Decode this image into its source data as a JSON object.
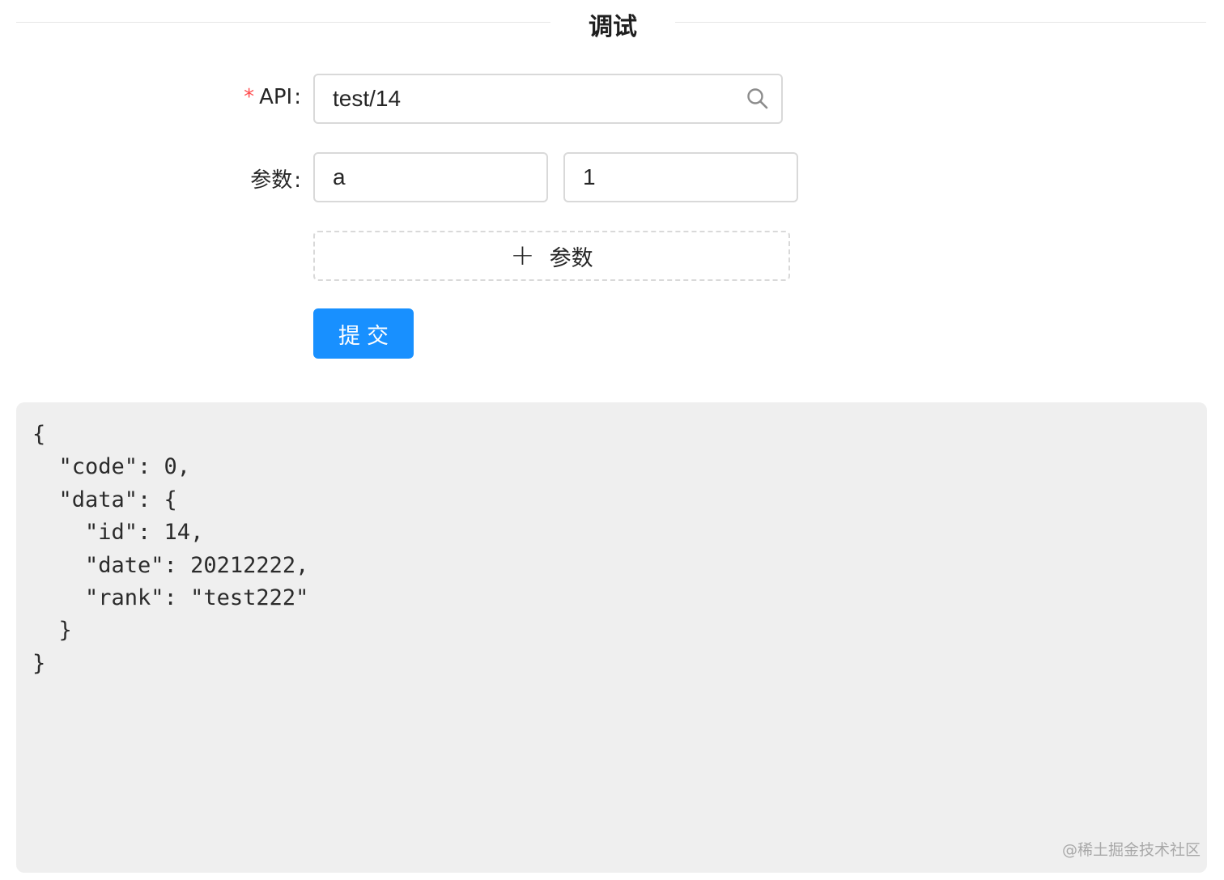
{
  "section": {
    "title": "调试"
  },
  "form": {
    "api": {
      "required_mark": "*",
      "label": "API",
      "colon": ":",
      "value": "test/14",
      "icon": "search-icon"
    },
    "params": {
      "label": "参数",
      "colon": ":",
      "key_value": "a",
      "value_value": "1"
    },
    "add_param_button": {
      "icon": "plus-icon",
      "label": "参数"
    },
    "submit_button": {
      "label": "提交",
      "color": "#1890ff"
    }
  },
  "response": {
    "text": "{\n  \"code\": 0,\n  \"data\": {\n    \"id\": 14,\n    \"date\": 20212222,\n    \"rank\": \"test222\"\n  }\n}"
  },
  "watermark": "@稀土掘金技术社区",
  "colors": {
    "required": "#ff4d4f",
    "border": "#d9d9d9",
    "response_bg": "#efefef"
  }
}
